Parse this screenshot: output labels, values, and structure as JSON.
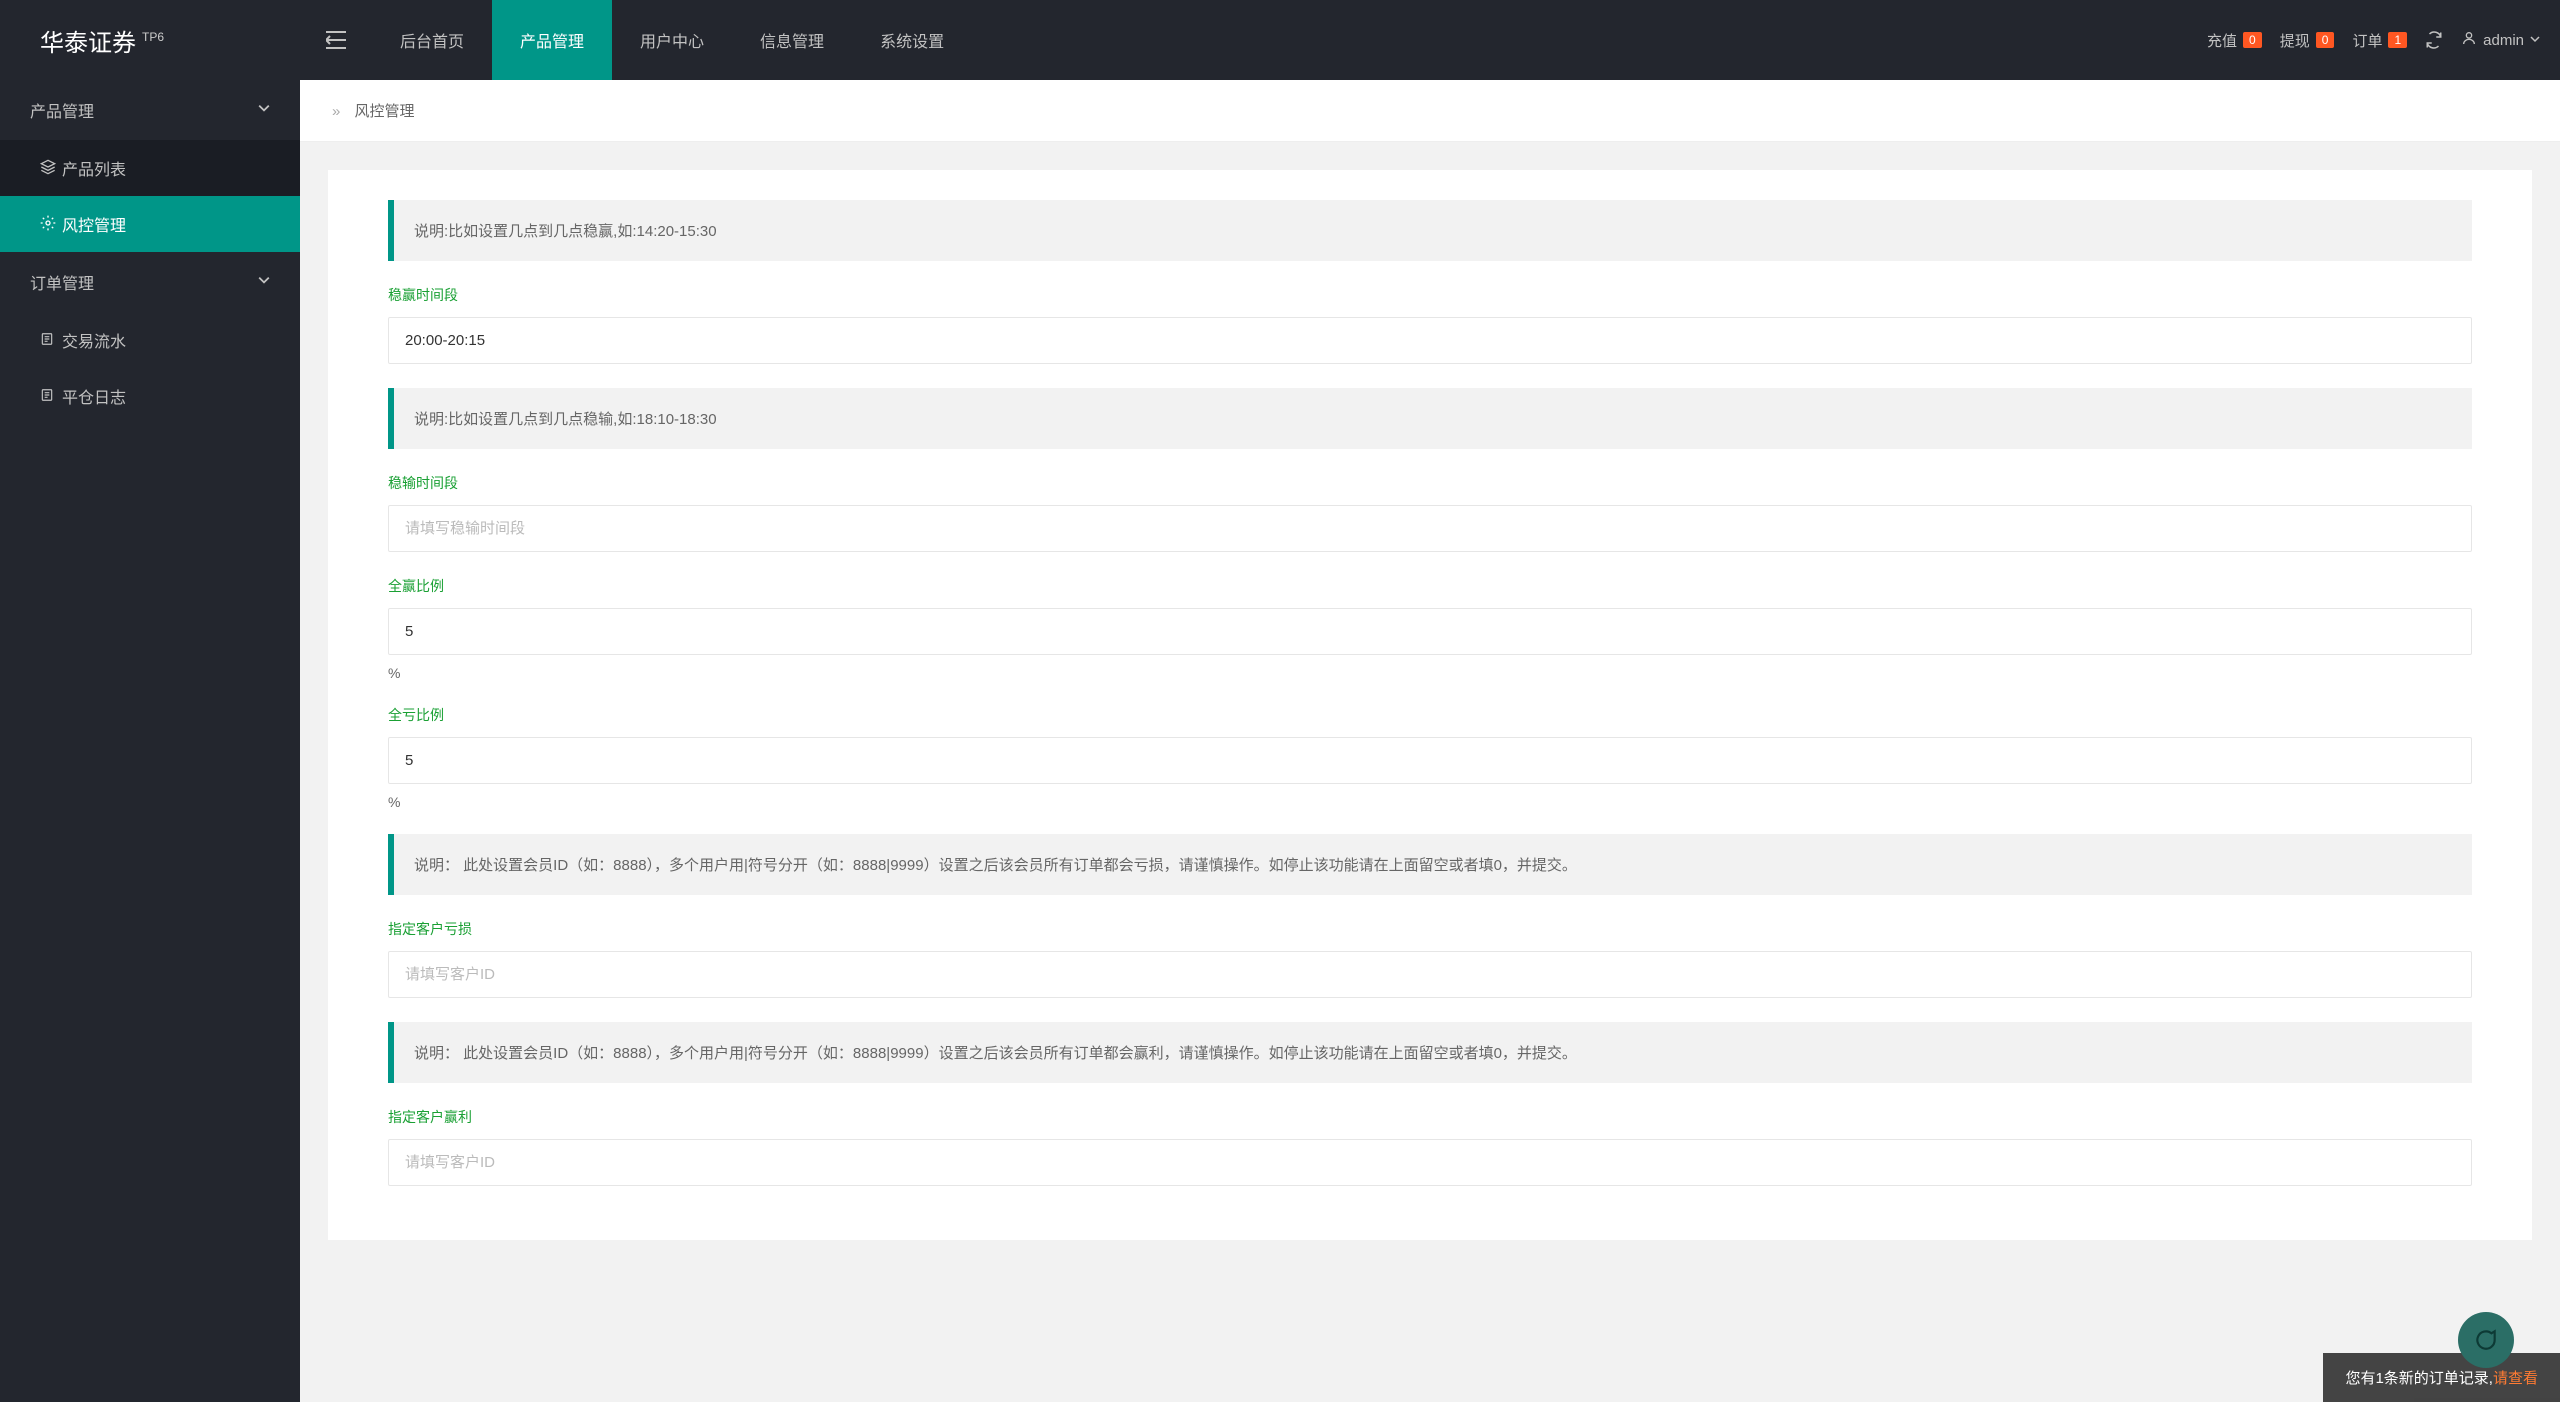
{
  "app": {
    "name": "华泰证券",
    "sup": "TP6"
  },
  "topnav": [
    "后台首页",
    "产品管理",
    "用户中心",
    "信息管理",
    "系统设置"
  ],
  "topnav_active": 1,
  "header_right": {
    "recharge": {
      "label": "充值",
      "count": "0"
    },
    "withdraw": {
      "label": "提现",
      "count": "0"
    },
    "order": {
      "label": "订单",
      "count": "1"
    },
    "user": "admin"
  },
  "sidebar": {
    "group1": "产品管理",
    "item_products": "产品列表",
    "item_risk": "风控管理",
    "group2": "订单管理",
    "item_flow": "交易流水",
    "item_log": "平仓日志"
  },
  "breadcrumb": {
    "page": "风控管理"
  },
  "form": {
    "bq1": "说明:比如设置几点到几点稳赢,如:14:20-15:30",
    "win_time_label": "稳赢时间段",
    "win_time_value": "20:00-20:15",
    "bq2": "说明:比如设置几点到几点稳输,如:18:10-18:30",
    "lose_time_label": "稳输时间段",
    "lose_time_placeholder": "请填写稳输时间段",
    "all_win_label": "全赢比例",
    "all_win_value": "5",
    "all_lose_label": "全亏比例",
    "all_lose_value": "5",
    "percent": "%",
    "bq3": "说明： 此处设置会员ID（如：8888），多个用户用|符号分开（如：8888|9999）设置之后该会员所有订单都会亏损，请谨慎操作。如停止该功能请在上面留空或者填0，并提交。",
    "target_lose_label": "指定客户亏损",
    "target_lose_placeholder": "请填写客户ID",
    "bq4": "说明： 此处设置会员ID（如：8888），多个用户用|符号分开（如：8888|9999）设置之后该会员所有订单都会赢利，请谨慎操作。如停止该功能请在上面留空或者填0，并提交。",
    "target_win_label": "指定客户赢利",
    "target_win_placeholder": "请填写客户ID"
  },
  "notif": {
    "text": "您有1条新的订单记录,",
    "link": "请查看"
  }
}
